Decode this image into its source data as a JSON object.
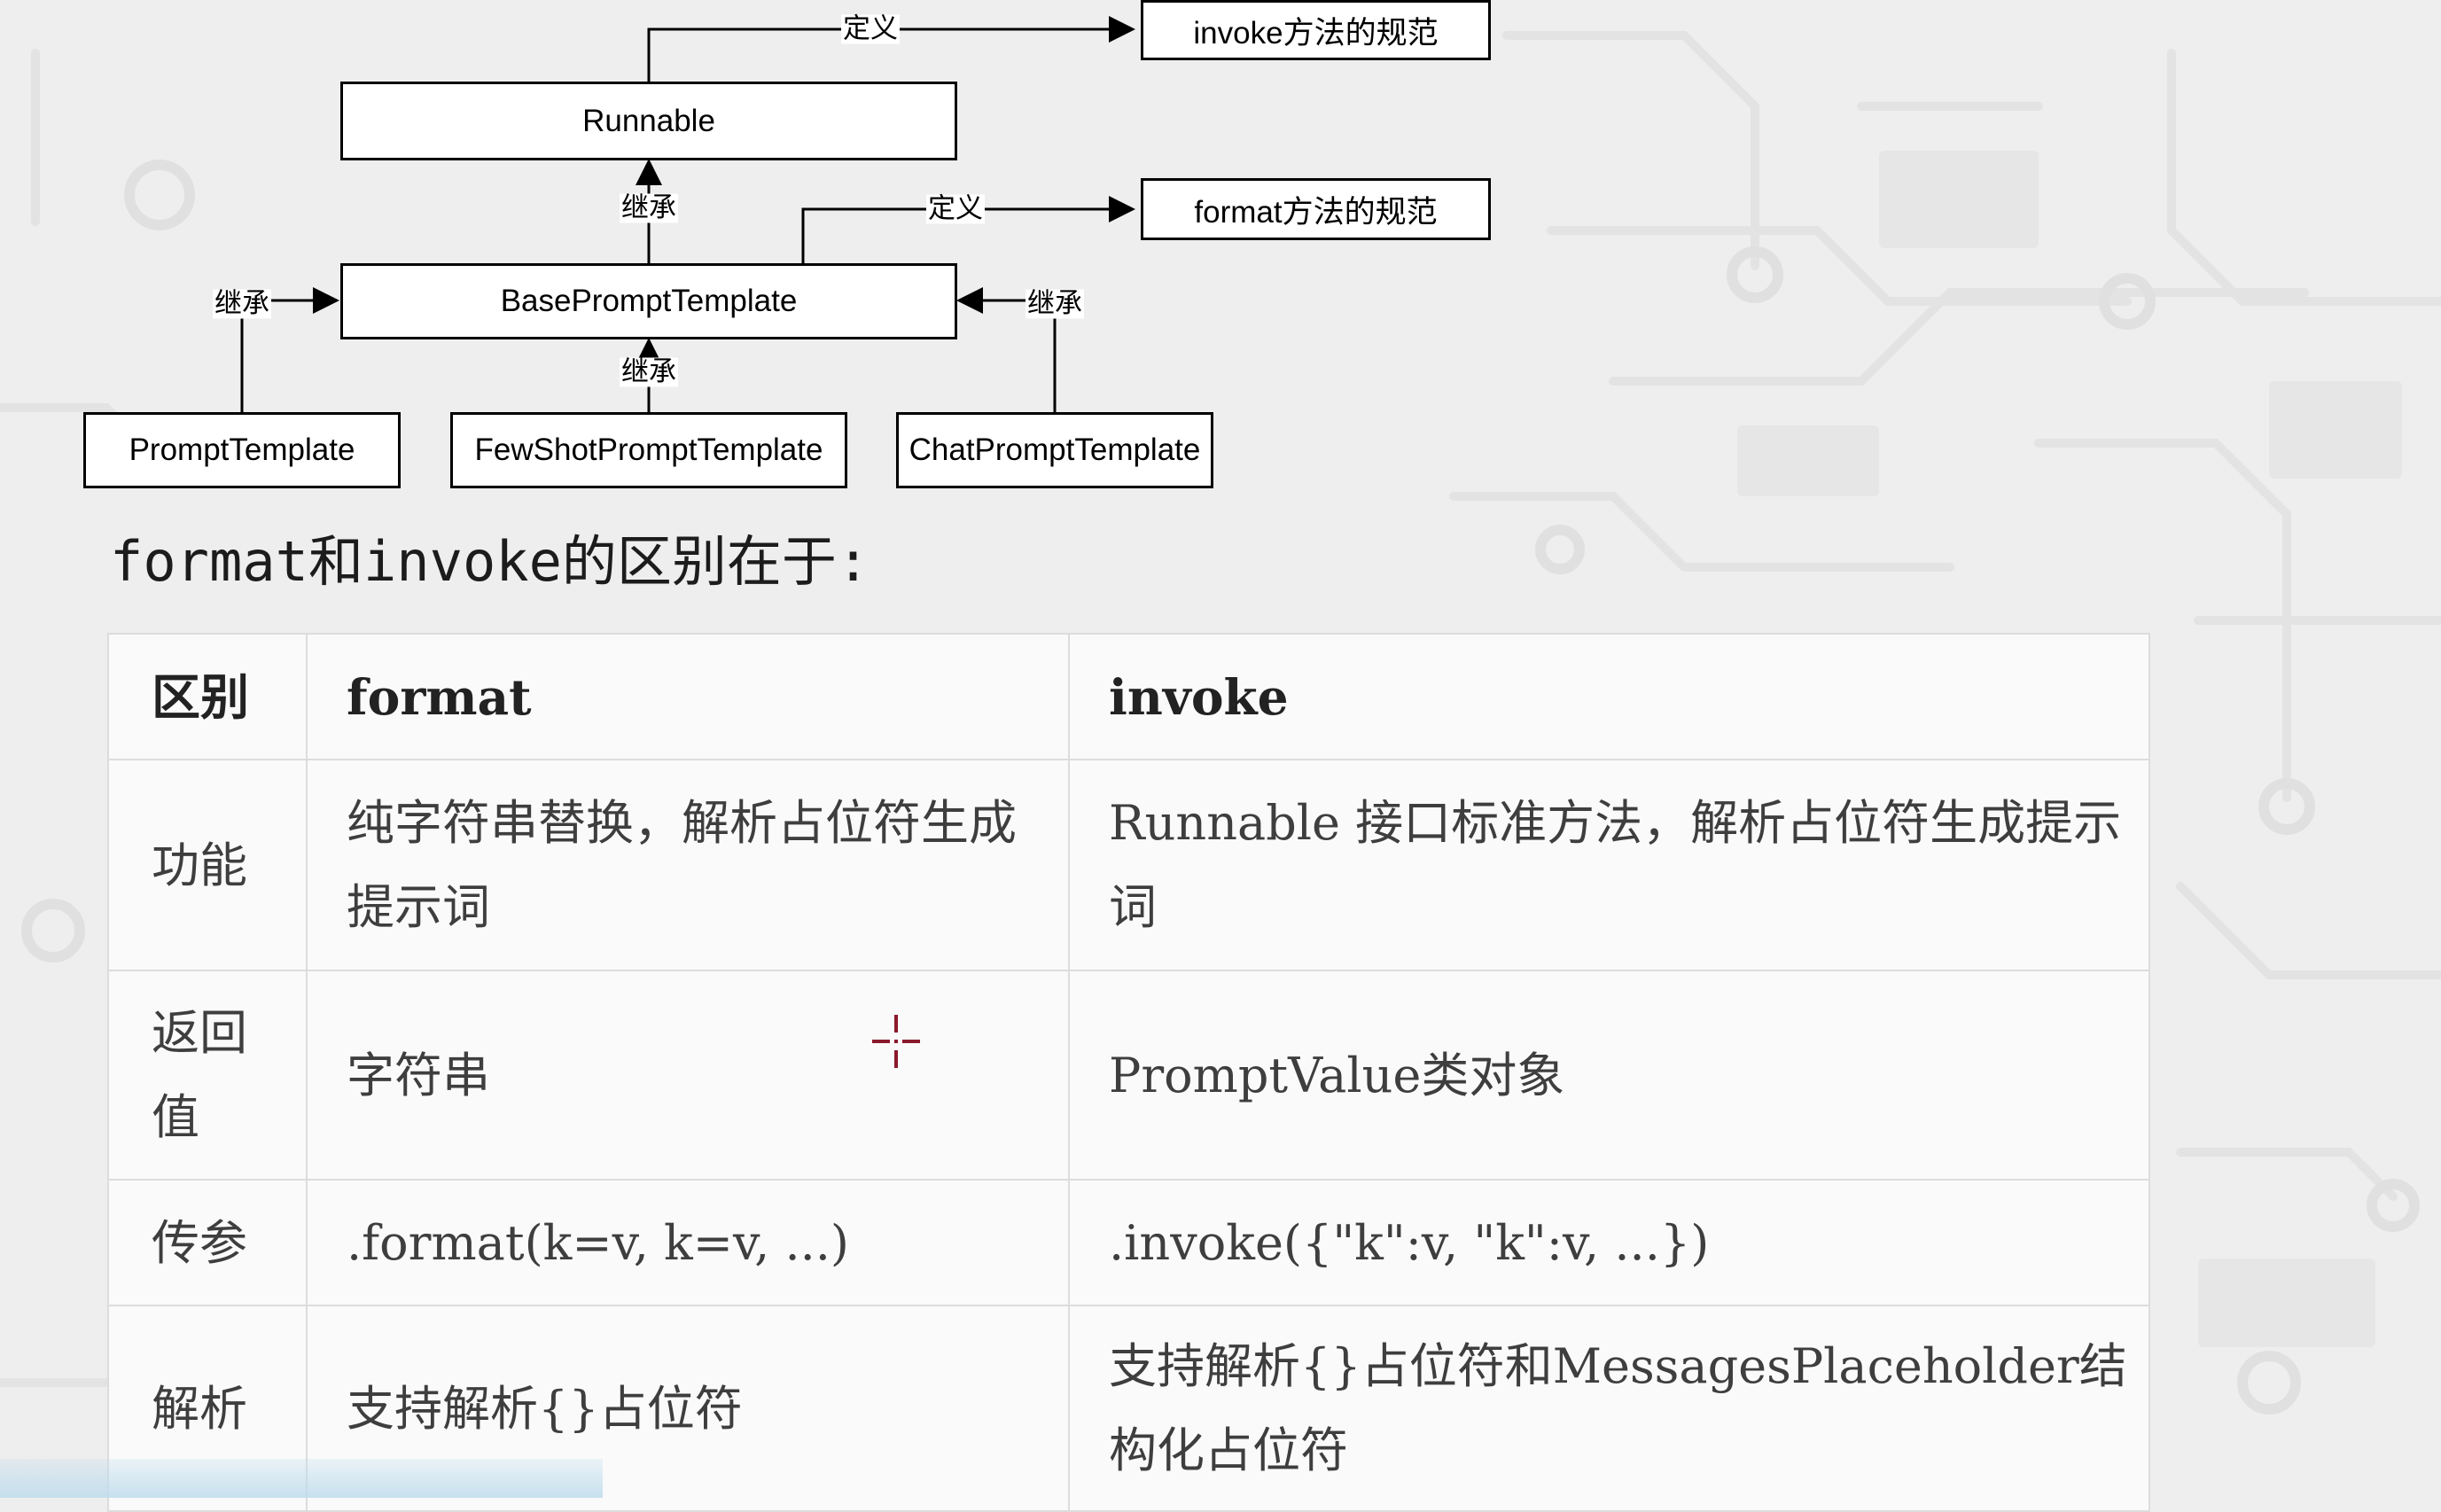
{
  "diagram": {
    "nodes": {
      "runnable": "Runnable",
      "invoke_spec": "invoke方法的规范",
      "format_spec": "format方法的规范",
      "base_prompt_template": "BasePromptTemplate",
      "prompt_template": "PromptTemplate",
      "few_shot_prompt_template": "FewShotPromptTemplate",
      "chat_prompt_template": "ChatPromptTemplate"
    },
    "edge_labels": {
      "define_invoke": "定义",
      "define_format": "定义",
      "inherit_runnable": "继承",
      "inherit_left": "继承",
      "inherit_middle": "继承",
      "inherit_right": "继承"
    }
  },
  "heading": "format和invoke的区别在于:",
  "table": {
    "headers": [
      "区别",
      "format",
      "invoke"
    ],
    "rows": [
      [
        "功能",
        "纯字符串替换，解析占位符生成提示词",
        "Runnable 接口标准方法，解析占位符生成提示词"
      ],
      [
        "返回值",
        "字符串",
        "PromptValue类对象"
      ],
      [
        "传参",
        ".format(k=v, k=v, ...)",
        ".invoke({\"k\":v, \"k\":v, ...})"
      ],
      [
        "解析",
        "支持解析{}占位符",
        "支持解析{}占位符和MessagesPlaceholder结构化占位符"
      ]
    ]
  },
  "colors": {
    "background": "#eeeeee",
    "circuit_pattern": "#e2e2e2",
    "table_border": "#dcdcdc",
    "table_text": "#3e3e3e",
    "cursor": "#8b1a2c"
  },
  "icons": {
    "cursor": "crosshair-cursor-icon"
  }
}
